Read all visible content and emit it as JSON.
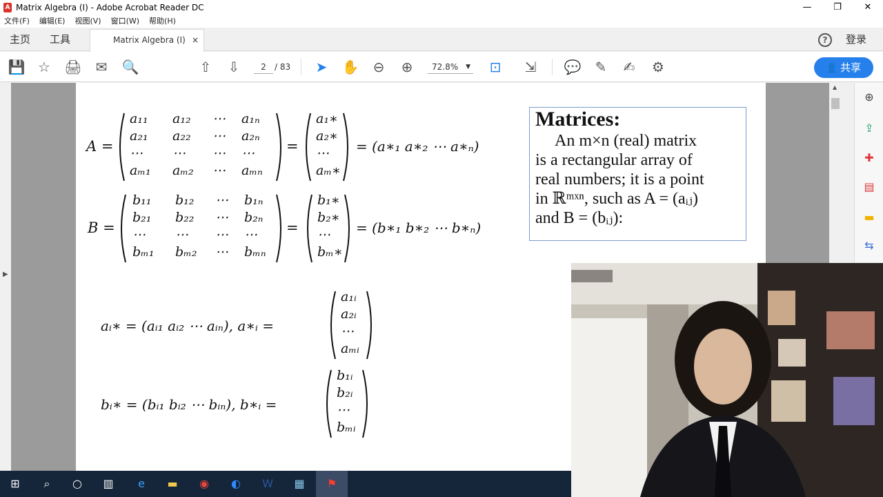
{
  "window": {
    "title": "Matrix Algebra (I) - Adobe Acrobat Reader DC",
    "controls": [
      "—",
      "❐",
      "✕"
    ]
  },
  "menu": [
    "文件(F)",
    "编辑(E)",
    "视图(V)",
    "窗口(W)",
    "帮助(H)"
  ],
  "tabs": {
    "home": "主页",
    "tools": "工具",
    "doc": "Matrix Algebra (I)",
    "close": "×"
  },
  "header": {
    "help": "?",
    "login": "登录"
  },
  "toolbar": {
    "page_current": "2",
    "page_total": "/ 83",
    "zoom": "72.8%",
    "share": "共享"
  },
  "icons": {
    "save": "💾",
    "star": "☆",
    "print": "🖨",
    "mail": "✉",
    "search": "🔍",
    "prev_page": "⇧",
    "next_page": "⇩",
    "select": "➤",
    "hand": "✋",
    "zoom_out": "⊖",
    "zoom_in": "⊕",
    "fit": "⊡",
    "scroll": "⇲",
    "comment": "💬",
    "highlight": "✎",
    "sign": "✍",
    "tools": "⚙"
  },
  "math": {
    "eqA_lhs": "A =",
    "eqA_rows": [
      [
        "a₁₁",
        "a₁₂",
        "⋯",
        "a₁ₙ"
      ],
      [
        "a₂₁",
        "a₂₂",
        "⋯",
        "a₂ₙ"
      ],
      [
        "⋯",
        "⋯",
        "⋯",
        "⋯"
      ],
      [
        "aₘ₁",
        "aₘ₂",
        "⋯",
        "aₘₙ"
      ]
    ],
    "eqA_col": [
      "a₁∗",
      "a₂∗",
      "⋯",
      "aₘ∗"
    ],
    "eqA_row": "= (a∗₁   a∗₂   ⋯   a∗ₙ)",
    "eqB_lhs": "B =",
    "eqB_rows": [
      [
        "b₁₁",
        "b₁₂",
        "⋯",
        "b₁ₙ"
      ],
      [
        "b₂₁",
        "b₂₂",
        "⋯",
        "b₂ₙ"
      ],
      [
        "⋯",
        "⋯",
        "⋯",
        "⋯"
      ],
      [
        "bₘ₁",
        "bₘ₂",
        "⋯",
        "bₘₙ"
      ]
    ],
    "eqB_col": [
      "b₁∗",
      "b₂∗",
      "⋯",
      "bₘ∗"
    ],
    "eqB_row": "= (b∗₁   b∗₂   ⋯   b∗ₙ)",
    "ai_row": "aᵢ∗ = (aᵢ₁   aᵢ₂   ⋯   aᵢₙ),  a∗ᵢ =",
    "ai_col": [
      "a₁ᵢ",
      "a₂ᵢ",
      "⋯",
      "aₘᵢ"
    ],
    "bi_row": "bᵢ∗ = (bᵢ₁   bᵢ₂   ⋯   bᵢₙ),  b∗ᵢ =",
    "bi_col": [
      "b₁ᵢ",
      "b₂ᵢ",
      "⋯",
      "bₘᵢ"
    ],
    "eq": "="
  },
  "box": {
    "heading": "Matrices:",
    "line1": "An m×n (real) matrix",
    "line2": "is a rectangular array of",
    "line3": "real numbers; it is a point",
    "line4": "in ℝᵐˣⁿ, such as A = (aᵢⱼ)",
    "line5": "and B = (bᵢⱼ):"
  }
}
